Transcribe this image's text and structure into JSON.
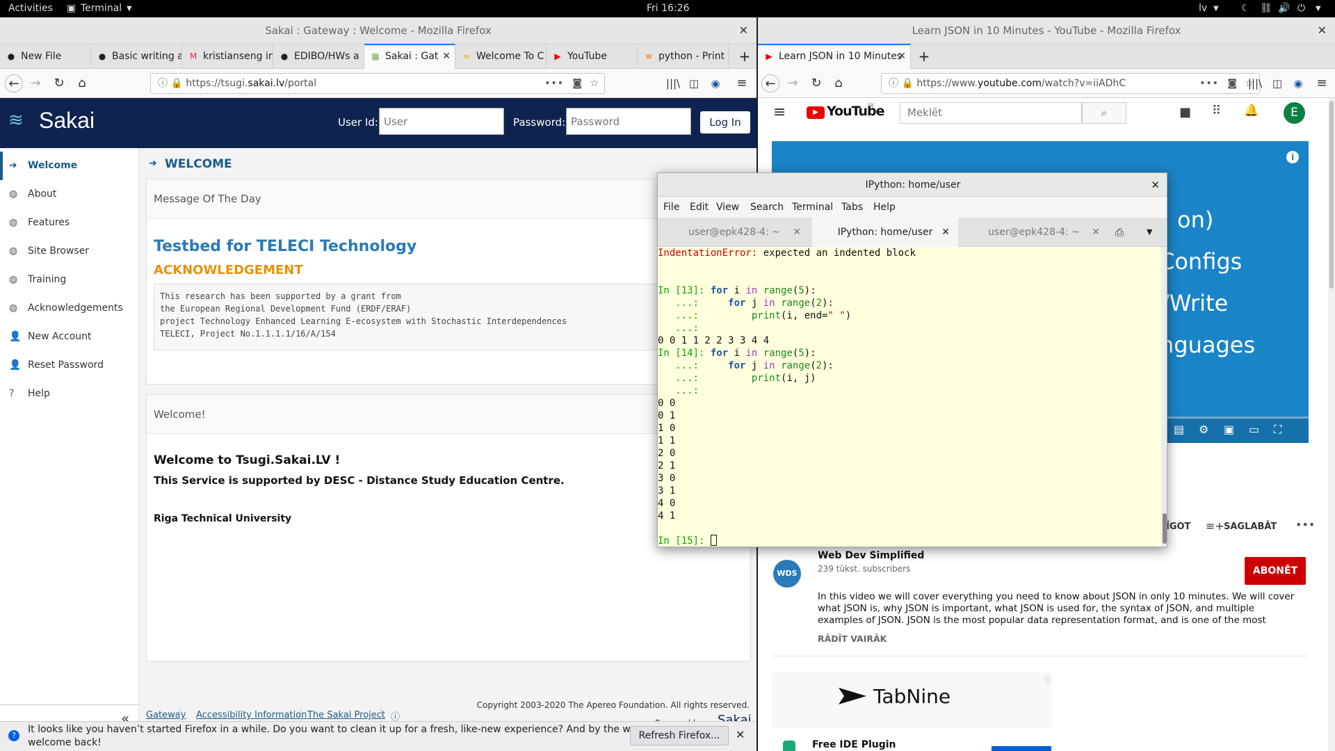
{
  "topbar": {
    "activities": "Activities",
    "app": "Terminal",
    "clock": "Fri 16:26",
    "lang": "lv"
  },
  "left": {
    "title": "Sakai : Gateway : Welcome - Mozilla Firefox",
    "tabs": [
      "New File",
      "Basic writing a",
      "kristianseng in",
      "EDIBO/HWs a",
      "Sakai : Gat",
      "Welcome To C",
      "YouTube",
      "python - Print"
    ],
    "url_prefix": "https://tsugi.",
    "url_host": "sakai.lv",
    "url_path": "/portal",
    "sakai": {
      "logo": "Sakai",
      "userid_label": "User Id:",
      "userid_placeholder": "User",
      "password_label": "Password:",
      "password_placeholder": "Password",
      "login": "Log In",
      "nav": [
        "Welcome",
        "About",
        "Features",
        "Site Browser",
        "Training",
        "Acknowledgements",
        "New Account",
        "Reset Password",
        "Help"
      ],
      "page_title": "WELCOME",
      "motd_header": "Message Of The Day",
      "testbed_title": "Testbed for TELECI Technology",
      "ack_title": "ACKNOWLEDGEMENT",
      "ack_lines": [
        "This research has been supported by a grant from",
        "the European Regional Development Fund (ERDF/ERAF)",
        "project Technology Enhanced Learning E-ecosystem with Stochastic Interdependences",
        "TELECI, Project No.1.1.1.1/16/A/154"
      ],
      "welcome_header": "Welcome!",
      "welcome_h1": "Welcome to Tsugi.Sakai.LV !",
      "welcome_h2": "This Service is supported by DESC - Distance Study Education Centre.",
      "welcome_univ": "Riga Technical University",
      "footer_links": [
        "Gateway",
        "Accessibility Information",
        "The Sakai Project"
      ],
      "copyright": "Copyright 2003-2020 The Apereo Foundation. All rights reserved.",
      "powered": "Powered by",
      "powered_logo": "Sakai"
    },
    "notice": "It looks like you haven't started Firefox in a while. Do you want to clean it up for a fresh, like-new experience? And by the way, welcome back!",
    "notice_line1": "It looks like you haven’t started Firefox in a while. Do you want to clean it up for a fresh, like-new experience? And by the way,",
    "notice_line2": "welcome back!",
    "refresh_btn": "Refresh Firefox..."
  },
  "right": {
    "title": "Learn JSON in 10 Minutes - YouTube - Mozilla Firefox",
    "tab": "Learn JSON in 10 Minutes",
    "url_prefix": "https://www.",
    "url_host": "youtube.com",
    "url_path": "/watch?v=iiADhC",
    "search_placeholder": "Meklēt",
    "logo": "YouTube",
    "logo_cc": "LV",
    "avatar": "E",
    "video_text": [
      "on)",
      "Configs",
      "/Write",
      "nguages"
    ],
    "action_share": "ĪGOT",
    "action_save": "SAGLABĀT",
    "channel": "Web Dev Simplified",
    "subs": "239 tūkst. subscribers",
    "subscribe": "ABONĒT",
    "desc_lines": [
      "In this video we will cover everything you need to know about JSON in only 10 minutes. We will cover",
      "what JSON is, why JSON is important, what JSON is used for, the syntax of JSON, and multiple",
      "examples of JSON. JSON is the most popular data representation format, and is one of the most"
    ],
    "show_more": "RĀDĪT VAIRĀK",
    "ad_brand": "TabNine",
    "ad_sub": "Free IDE Plugin",
    "channel_badge": "WDS"
  },
  "terminal": {
    "title": "IPython: home/user",
    "menu": [
      "File",
      "Edit",
      "View",
      "Search",
      "Terminal",
      "Tabs",
      "Help"
    ],
    "tabs": [
      "user@epk428-4: ~",
      "IPython: home/user",
      "user@epk428-4: ~"
    ],
    "error_name": "IndentationError:",
    "error_msg": " expected an indented block",
    "in13": "In [13]:",
    "in14": "In [14]:",
    "in15": "In [15]:",
    "cont": "   ...:",
    "output13": "0 0 1 1 2 2 3 3 4 4",
    "output14": [
      "0 0",
      "0 1",
      "1 0",
      "1 1",
      "2 0",
      "2 1",
      "3 0",
      "3 1",
      "4 0",
      "4 1"
    ]
  }
}
